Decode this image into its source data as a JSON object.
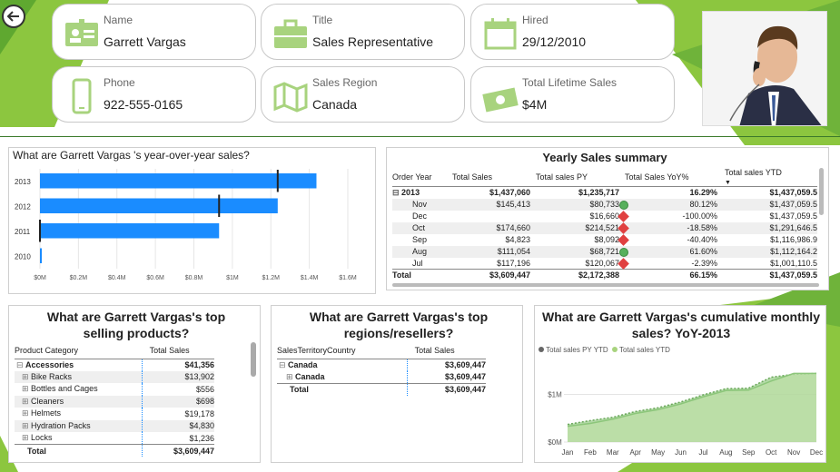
{
  "profile": {
    "name": {
      "label": "Name",
      "value": "Garrett Vargas",
      "icon": "id-card-icon"
    },
    "title": {
      "label": "Title",
      "value": "Sales Representative",
      "icon": "briefcase-icon"
    },
    "hired": {
      "label": "Hired",
      "value": "29/12/2010",
      "icon": "calendar-icon"
    },
    "phone": {
      "label": "Phone",
      "value": "922-555-0165",
      "icon": "phone-icon"
    },
    "region": {
      "label": "Sales Region",
      "value": "Canada",
      "icon": "map-icon"
    },
    "lifetime": {
      "label": "Total Lifetime Sales",
      "value": "$4M",
      "icon": "money-icon"
    }
  },
  "colors": {
    "accent": "#8cc63f",
    "bar": "#1a8cff",
    "card_icon": "#a8d37e",
    "area_dark": "#7fbf6a",
    "area_light": "#bfe0a8"
  },
  "yoy": {
    "title": "What are Garrett Vargas 's year-over-year sales?",
    "chart_data": {
      "type": "bar",
      "orientation": "horizontal",
      "categories": [
        "2013",
        "2012",
        "2011",
        "2010"
      ],
      "values": [
        1437060,
        1235717,
        931000,
        9000
      ],
      "targets": [
        1235717,
        931000,
        0,
        null
      ],
      "xlim": [
        0,
        1600000
      ],
      "xticks": [
        "$0M",
        "$0.2M",
        "$0.4M",
        "$0.6M",
        "$0.8M",
        "$1M",
        "$1.2M",
        "$1.4M",
        "$1.6M"
      ]
    }
  },
  "yearly": {
    "title": "Yearly Sales summary",
    "headers": [
      "Order Year",
      "Total Sales",
      "Total sales PY",
      "Total Sales YoY%",
      "Total sales YTD"
    ],
    "rows": [
      {
        "label": "2013",
        "sales": "$1,437,060",
        "py": "$1,235,717",
        "ind": "",
        "yoy": "16.29%",
        "ytd": "$1,437,059.5",
        "bold": true,
        "expand": "⊟"
      },
      {
        "label": "Nov",
        "sales": "$145,413",
        "py": "$80,733",
        "ind": "green",
        "yoy": "80.12%",
        "ytd": "$1,437,059.5"
      },
      {
        "label": "Dec",
        "sales": "",
        "py": "$16,660",
        "ind": "red",
        "yoy": "-100.00%",
        "ytd": "$1,437,059.5"
      },
      {
        "label": "Oct",
        "sales": "$174,660",
        "py": "$214,521",
        "ind": "red",
        "yoy": "-18.58%",
        "ytd": "$1,291,646.5"
      },
      {
        "label": "Sep",
        "sales": "$4,823",
        "py": "$8,092",
        "ind": "red",
        "yoy": "-40.40%",
        "ytd": "$1,116,986.9"
      },
      {
        "label": "Aug",
        "sales": "$111,054",
        "py": "$68,721",
        "ind": "green",
        "yoy": "61.60%",
        "ytd": "$1,112,164.2"
      },
      {
        "label": "Jul",
        "sales": "$117,196",
        "py": "$120,067",
        "ind": "red",
        "yoy": "-2.39%",
        "ytd": "$1,001,110.5"
      },
      {
        "label": "Total",
        "sales": "$3,609,447",
        "py": "$2,172,388",
        "ind": "",
        "yoy": "66.15%",
        "ytd": "$1,437,059.5",
        "bold": true
      }
    ]
  },
  "products": {
    "title": "What are Garrett Vargas's top selling products?",
    "headers": [
      "Product Category",
      "Total Sales"
    ],
    "rows": [
      {
        "label": "Accessories",
        "value": "$41,356",
        "expand": "⊟",
        "bold": true
      },
      {
        "label": "Bike Racks",
        "value": "$13,902",
        "expand": "⊞"
      },
      {
        "label": "Bottles and Cages",
        "value": "$556",
        "expand": "⊞"
      },
      {
        "label": "Cleaners",
        "value": "$698",
        "expand": "⊞"
      },
      {
        "label": "Helmets",
        "value": "$19,178",
        "expand": "⊞"
      },
      {
        "label": "Hydration Packs",
        "value": "$4,830",
        "expand": "⊞"
      },
      {
        "label": "Locks",
        "value": "$1,236",
        "expand": "⊞"
      },
      {
        "label": "Total",
        "value": "$3,609,447",
        "bold": true
      }
    ]
  },
  "regions": {
    "title": "What are Garrett Vargas's top regions/resellers?",
    "headers": [
      "SalesTerritoryCountry",
      "Total Sales"
    ],
    "rows": [
      {
        "label": "Canada",
        "value": "$3,609,447",
        "expand": "⊟",
        "bold": true
      },
      {
        "label": "Canada",
        "value": "$3,609,447",
        "expand": "⊞",
        "bold": true,
        "indent": true
      },
      {
        "label": "Total",
        "value": "$3,609,447",
        "bold": true
      }
    ]
  },
  "cumulative": {
    "title": "What are Garrett Vargas's cumulative monthly sales? YoY-2013",
    "chart_data": {
      "type": "area",
      "x": [
        "Jan",
        "Feb",
        "Mar",
        "Apr",
        "May",
        "Jun",
        "Jul",
        "Aug",
        "Sep",
        "Oct",
        "Nov",
        "Dec"
      ],
      "series": [
        {
          "name": "Total sales PY YTD",
          "values": [
            0.37,
            0.45,
            0.52,
            0.64,
            0.72,
            0.84,
            0.99,
            1.12,
            1.13,
            1.36,
            1.42,
            1.44
          ]
        },
        {
          "name": "Total sales YTD",
          "values": [
            0.33,
            0.39,
            0.48,
            0.6,
            0.68,
            0.8,
            0.95,
            1.08,
            1.09,
            1.28,
            1.44,
            1.44
          ]
        }
      ],
      "ylim": [
        0,
        1.6
      ],
      "yticks": [
        "$0M",
        "$1M"
      ],
      "legend": "top-left"
    }
  }
}
